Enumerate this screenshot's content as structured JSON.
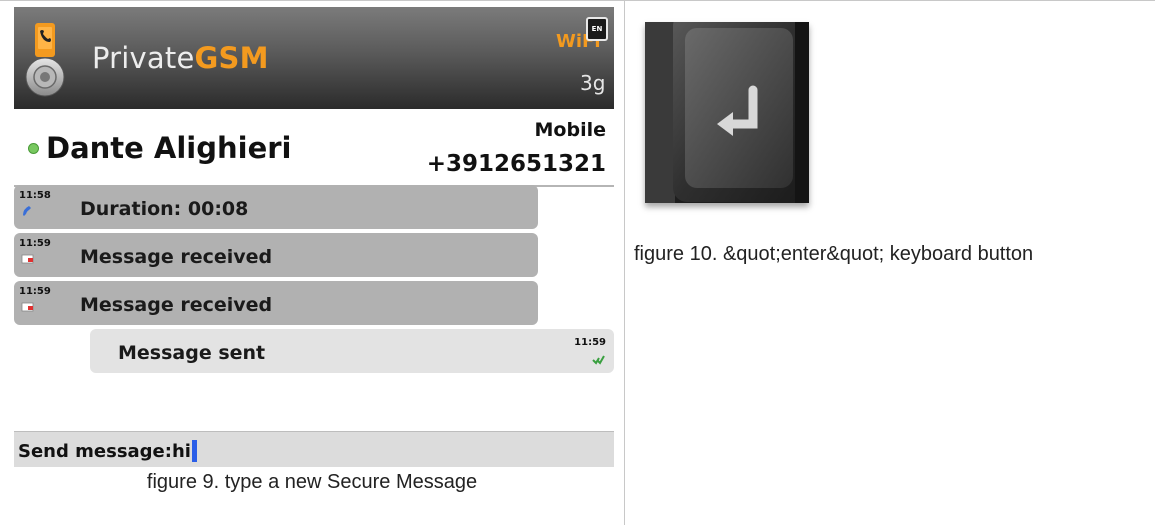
{
  "figure9": {
    "app": {
      "name_prefix": "Private",
      "name_accent": "GSM",
      "language_badge": "EN",
      "wifi_label": "WiFi",
      "network_label": "3g",
      "logo_icon": "phone-handset-logo-icon"
    },
    "contact": {
      "status": "online",
      "status_color": "#78c860",
      "name": "Dante Alighieri",
      "phone_type": "Mobile",
      "phone_number": "+3912651321"
    },
    "messages": [
      {
        "direction": "in",
        "time": "11:58",
        "icon": "call-icon",
        "text": "Duration:  00:08"
      },
      {
        "direction": "in",
        "time": "11:59",
        "icon": "message-received-icon",
        "text": "Message received"
      },
      {
        "direction": "in",
        "time": "11:59",
        "icon": "message-received-icon",
        "text": "Message received"
      },
      {
        "direction": "out",
        "time": "11:59",
        "icon": "message-sent-check-icon",
        "text": "Message sent"
      }
    ],
    "compose": {
      "label": "Send message:",
      "value": "hi"
    },
    "caption": "figure 9. type a new Secure Message"
  },
  "figure10": {
    "image_icon": "enter-key-photo",
    "caption": "figure 10. &quot;enter&quot; keyboard button"
  },
  "colors": {
    "accent": "#f39a1f",
    "incoming_bubble": "#b1b1b1",
    "outgoing_bubble": "#e3e3e3",
    "caret": "#2a5ee8"
  }
}
